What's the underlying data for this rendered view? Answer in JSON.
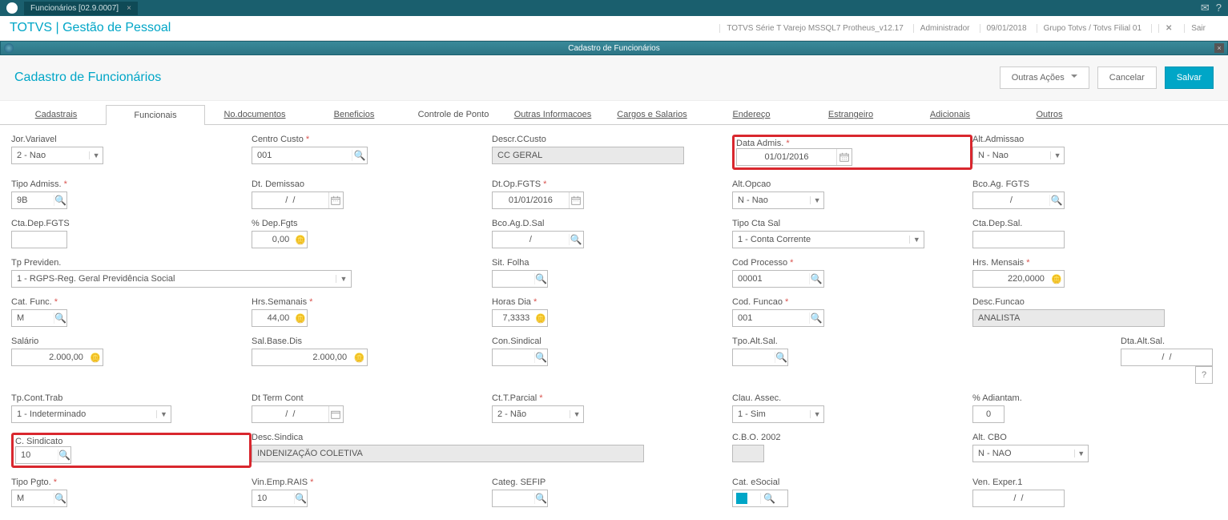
{
  "titlebar": {
    "tab_label": "Funcionários [02.9.0007]",
    "tab_close": "×",
    "mail_icon": "✉",
    "help_icon": "?"
  },
  "header": {
    "brand": "TOTVS | Gestão de Pessoal",
    "env": "TOTVS Série T Varejo MSSQL7 Protheus_v12.17",
    "user": "Administrador",
    "date": "09/01/2018",
    "branch": "Grupo Totvs / Totvs Filial 01",
    "exit_x": "✕",
    "exit_label": "Sair"
  },
  "subhead": {
    "title": "Cadastro de Funcionários",
    "close": "×"
  },
  "toolbar": {
    "page_title": "Cadastro de Funcionários",
    "other_actions": "Outras Ações",
    "cancel": "Cancelar",
    "save": "Salvar"
  },
  "tabs": [
    "Cadastrais",
    "Funcionais",
    "No.documentos",
    "Beneficios",
    "Controle de Ponto",
    "Outras Informacoes",
    "Cargos e Salarios",
    "Endereço",
    "Estrangeiro",
    "Adicionais",
    "Outros"
  ],
  "form": {
    "jor_variavel": {
      "label": "Jor.Variavel",
      "value": "2 - Nao"
    },
    "centro_custo": {
      "label": "Centro Custo",
      "value": "001"
    },
    "descr_ccusto": {
      "label": "Descr.CCusto",
      "value": "CC GERAL"
    },
    "data_admis": {
      "label": "Data Admis.",
      "value": "01/01/2016"
    },
    "alt_admissao": {
      "label": "Alt.Admissao",
      "value": "N - Nao"
    },
    "tipo_admiss": {
      "label": "Tipo Admiss.",
      "value": "9B"
    },
    "dt_demissao": {
      "label": "Dt. Demissao",
      "value": "/  /"
    },
    "dt_op_fgts": {
      "label": "Dt.Op.FGTS",
      "value": "01/01/2016"
    },
    "alt_opcao": {
      "label": "Alt.Opcao",
      "value": "N - Nao"
    },
    "bco_ag_fgts": {
      "label": "Bco.Ag. FGTS",
      "value": "/"
    },
    "cta_dep_fgts": {
      "label": "Cta.Dep.FGTS",
      "value": ""
    },
    "pct_dep_fgts": {
      "label": "% Dep.Fgts",
      "value": "0,00"
    },
    "bco_ag_d_sal": {
      "label": "Bco.Ag.D.Sal",
      "value": "/"
    },
    "tipo_cta_sal": {
      "label": "Tipo Cta Sal",
      "value": "1 - Conta Corrente"
    },
    "cta_dep_sal": {
      "label": "Cta.Dep.Sal.",
      "value": ""
    },
    "tp_previden": {
      "label": "Tp Previden.",
      "value": "1 - RGPS-Reg. Geral Previdência Social"
    },
    "sit_folha": {
      "label": "Sit. Folha",
      "value": ""
    },
    "cod_processo": {
      "label": "Cod Processo",
      "value": "00001"
    },
    "hrs_mensais": {
      "label": "Hrs. Mensais",
      "value": "220,0000"
    },
    "cat_func": {
      "label": "Cat. Func.",
      "value": "M"
    },
    "hrs_semanais": {
      "label": "Hrs.Semanais",
      "value": "44,00"
    },
    "horas_dia": {
      "label": "Horas Dia",
      "value": "7,3333"
    },
    "cod_funcao": {
      "label": "Cod. Funcao",
      "value": "001"
    },
    "desc_funcao": {
      "label": "Desc.Funcao",
      "value": "ANALISTA"
    },
    "salario": {
      "label": "Salário",
      "value": "2.000,00"
    },
    "sal_base_dis": {
      "label": "Sal.Base.Dis",
      "value": "2.000,00"
    },
    "con_sindical": {
      "label": "Con.Sindical",
      "value": ""
    },
    "tpo_alt_sal": {
      "label": "Tpo.Alt.Sal.",
      "value": ""
    },
    "dta_alt_sal": {
      "label": "Dta.Alt.Sal.",
      "value": "/  /"
    },
    "tp_cont_trab": {
      "label": "Tp.Cont.Trab",
      "value": "1 - Indeterminado"
    },
    "dt_term_cont": {
      "label": "Dt Term Cont",
      "value": "/  /"
    },
    "ct_t_parcial": {
      "label": "Ct.T.Parcial",
      "value": "2 - Não"
    },
    "clau_assec": {
      "label": "Clau. Assec.",
      "value": "1 - Sim"
    },
    "pct_adiantam": {
      "label": "% Adiantam.",
      "value": "0"
    },
    "c_sindicato": {
      "label": "C. Sindicato",
      "value": "10"
    },
    "desc_sindica": {
      "label": "Desc.Sindica",
      "value": "INDENIZAÇÃO COLETIVA"
    },
    "cbo_2002": {
      "label": "C.B.O. 2002",
      "value": ""
    },
    "alt_cbo": {
      "label": "Alt. CBO",
      "value": "N - NAO"
    },
    "tipo_pgto": {
      "label": "Tipo Pgto.",
      "value": "M"
    },
    "vin_emp_rais": {
      "label": "Vin.Emp.RAIS",
      "value": "10"
    },
    "categ_sefip": {
      "label": "Categ. SEFIP",
      "value": ""
    },
    "cat_esocial": {
      "label": "Cat. eSocial",
      "value": ""
    },
    "ven_exper1": {
      "label": "Ven. Exper.1",
      "value": "/  /"
    }
  },
  "icons": {
    "mag": "🔍",
    "coin": "🪙",
    "help": "?"
  }
}
